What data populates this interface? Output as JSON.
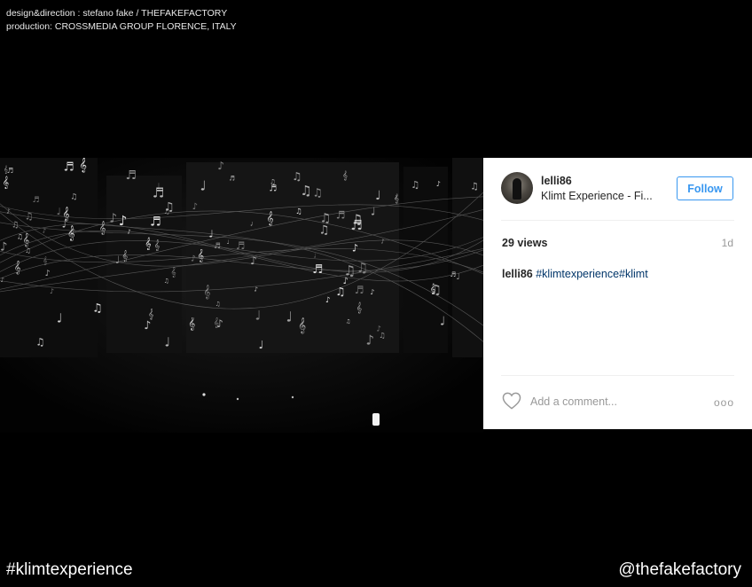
{
  "credits": {
    "line1": "design&direction : stefano fake / THEFAKEFACTORY",
    "line2": "production: CROSSMEDIA GROUP FLORENCE, ITALY"
  },
  "post": {
    "username": "lelli86",
    "location": "Klimt Experience - Fi...",
    "follow_label": "Follow",
    "views": "29 views",
    "age": "1d",
    "caption_user": "lelli86",
    "caption_tags": "#klimtexperience#klimt",
    "comment_placeholder": "Add a comment...",
    "more_label": "ooo",
    "colors": {
      "accent": "#3897f0",
      "hashtag": "#003569"
    }
  },
  "footer": {
    "hashtag": "#klimtexperience",
    "handle": "@thefakefactory"
  }
}
